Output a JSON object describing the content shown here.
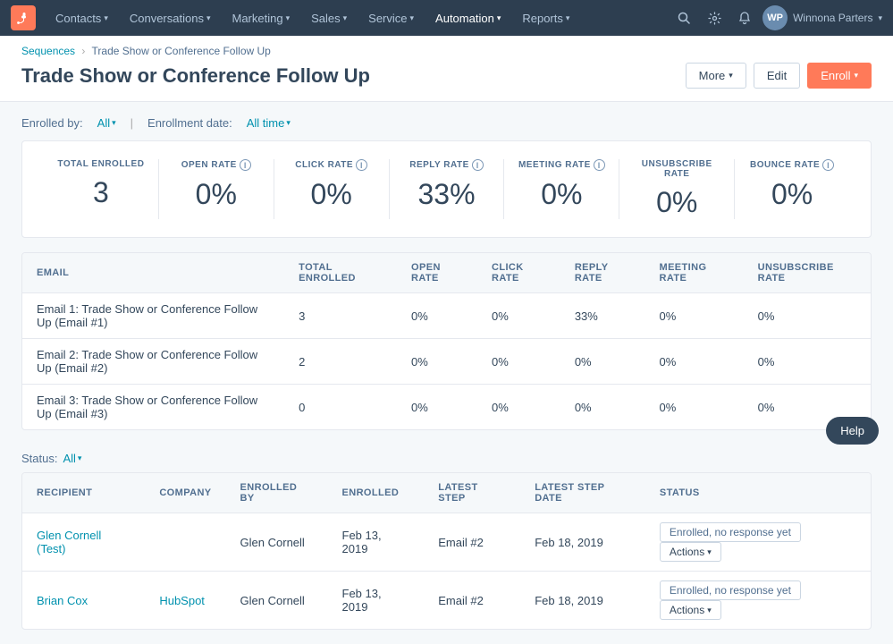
{
  "nav": {
    "logo_text": "H",
    "items": [
      {
        "label": "Contacts",
        "has_dropdown": true
      },
      {
        "label": "Conversations",
        "has_dropdown": true
      },
      {
        "label": "Marketing",
        "has_dropdown": true
      },
      {
        "label": "Sales",
        "has_dropdown": true
      },
      {
        "label": "Service",
        "has_dropdown": true
      },
      {
        "label": "Automation",
        "has_dropdown": true
      },
      {
        "label": "Reports",
        "has_dropdown": true
      }
    ],
    "user_name": "Winnona Parters",
    "user_initials": "WP"
  },
  "breadcrumb": {
    "parent_label": "Sequences",
    "current_label": "Trade Show or Conference Follow Up"
  },
  "page_title": "Trade Show or Conference Follow Up",
  "header_actions": {
    "more_label": "More",
    "edit_label": "Edit",
    "enroll_label": "Enroll"
  },
  "filters": {
    "enrolled_by_label": "Enrolled by:",
    "enrolled_by_value": "All",
    "enrollment_date_label": "Enrollment date:",
    "enrollment_date_value": "All time"
  },
  "stats": [
    {
      "label": "TOTAL ENROLLED",
      "value": "3",
      "has_info": false
    },
    {
      "label": "OPEN RATE",
      "value": "0%",
      "has_info": true
    },
    {
      "label": "CLICK RATE",
      "value": "0%",
      "has_info": true
    },
    {
      "label": "REPLY RATE",
      "value": "33%",
      "has_info": true
    },
    {
      "label": "MEETING RATE",
      "value": "0%",
      "has_info": true
    },
    {
      "label": "UNSUBSCRIBE RATE",
      "value": "0%",
      "has_info": false
    },
    {
      "label": "BOUNCE RATE",
      "value": "0%",
      "has_info": true
    }
  ],
  "email_table": {
    "columns": [
      "EMAIL",
      "TOTAL ENROLLED",
      "OPEN RATE",
      "CLICK RATE",
      "REPLY RATE",
      "MEETING RATE",
      "UNSUBSCRIBE RATE"
    ],
    "rows": [
      {
        "email": "Email 1: Trade Show or Conference Follow Up (Email #1)",
        "total_enrolled": "3",
        "open_rate": "0%",
        "click_rate": "0%",
        "reply_rate": "33%",
        "meeting_rate": "0%",
        "unsubscribe_rate": "0%"
      },
      {
        "email": "Email 2: Trade Show or Conference Follow Up (Email #2)",
        "total_enrolled": "2",
        "open_rate": "0%",
        "click_rate": "0%",
        "reply_rate": "0%",
        "meeting_rate": "0%",
        "unsubscribe_rate": "0%"
      },
      {
        "email": "Email 3: Trade Show or Conference Follow Up (Email #3)",
        "total_enrolled": "0",
        "open_rate": "0%",
        "click_rate": "0%",
        "reply_rate": "0%",
        "meeting_rate": "0%",
        "unsubscribe_rate": "0%"
      }
    ]
  },
  "status_filter": {
    "label": "Status:",
    "value": "All"
  },
  "recipients_table": {
    "columns": [
      "RECIPIENT",
      "COMPANY",
      "ENROLLED BY",
      "ENROLLED",
      "LATEST STEP",
      "LATEST STEP DATE",
      "STATUS"
    ],
    "rows": [
      {
        "recipient": "Glen Cornell (Test)",
        "company": "",
        "enrolled_by": "Glen Cornell",
        "enrolled": "Feb 13, 2019",
        "latest_step": "Email #2",
        "latest_step_date": "Feb 18, 2019",
        "status": "Enrolled, no response yet"
      },
      {
        "recipient": "Brian Cox",
        "company": "HubSpot",
        "enrolled_by": "Glen Cornell",
        "enrolled": "Feb 13, 2019",
        "latest_step": "Email #2",
        "latest_step_date": "Feb 18, 2019",
        "status": "Enrolled, no response yet"
      }
    ]
  },
  "help_button": "Help"
}
